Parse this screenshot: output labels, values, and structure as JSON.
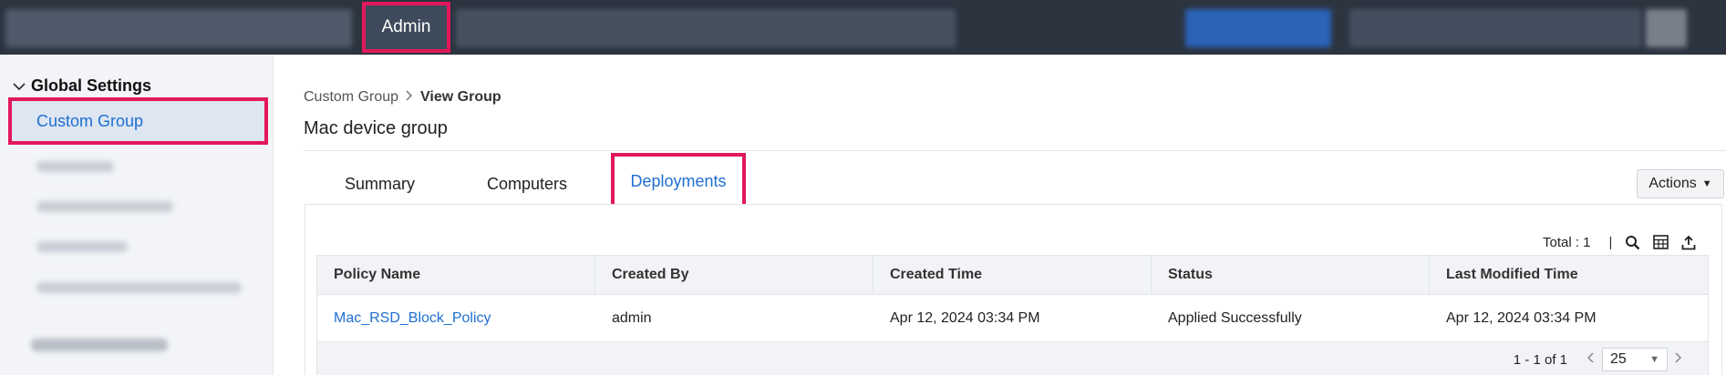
{
  "topbar": {
    "active_tab": "Admin"
  },
  "sidebar": {
    "section_title": "Global Settings",
    "active_item": "Custom Group"
  },
  "breadcrumb": {
    "parent": "Custom Group",
    "current": "View Group"
  },
  "page": {
    "title": "Mac device group"
  },
  "tabs": {
    "summary": "Summary",
    "computers": "Computers",
    "deployments": "Deployments"
  },
  "actions_label": "Actions",
  "toolbar": {
    "total": "Total : 1",
    "separator": "|"
  },
  "table": {
    "columns": [
      "Policy Name",
      "Created By",
      "Created Time",
      "Status",
      "Last Modified Time"
    ],
    "rows": [
      [
        "Mac_RSD_Block_Policy",
        "admin",
        "Apr 12, 2024 03:34 PM",
        "Applied Successfully",
        "Apr 12, 2024 03:34 PM"
      ]
    ]
  },
  "pagination": {
    "range": "1 - 1 of 1",
    "page_size": "25"
  },
  "colors": {
    "highlight": "#e2185b",
    "link": "#1f6fd1",
    "topbar_bg": "#2c3440"
  }
}
